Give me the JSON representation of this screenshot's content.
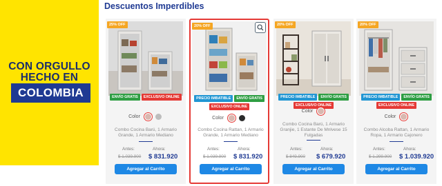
{
  "banner": {
    "line1": "CON ORGULLO",
    "line2": "HECHO EN",
    "country": "COLOMBIA",
    "colors": {
      "background": "#ffe400",
      "text": "#1a2d6b",
      "box": "#1f3a93"
    }
  },
  "section": {
    "title": "Descuentos Imperdibles"
  },
  "labels": {
    "color": "Color",
    "before": "Antes:",
    "now": "Ahora:",
    "add_to_cart": "Agregar al Carrito"
  },
  "products": [
    {
      "discount": "25% OFF",
      "tags_row1": [
        "ENVÍO GRATIS",
        "EXCLUSIVO ONLINE"
      ],
      "tags_row2": [],
      "swatches": [
        "#d9b8b0",
        "#bdbdbd"
      ],
      "name": "Combo Cocina Barú, 1 Armario Grande, 1 Armario Mediano",
      "old_price": "$ 1.039.900",
      "new_price": "$ 831.920"
    },
    {
      "discount": "20% OFF",
      "tags_row1": [
        "PRECIO IMBATIBLE",
        "ENVÍO GRATIS"
      ],
      "tags_row2": [
        "EXCLUSIVO ONLINE"
      ],
      "swatches": [
        "#d9b8b0",
        "#2b2b2b"
      ],
      "name": "Combo Cocina Rattan, 1 Armario Grande, 1 Armario Mediano",
      "old_price": "$ 1.039.900",
      "new_price": "$ 831.920"
    },
    {
      "discount": "20% OFF",
      "tags_row1": [
        "PRECIO IMBATIBLE",
        "ENVÍO GRATIS"
      ],
      "tags_row2": [
        "EXCLUSIVO ONLINE"
      ],
      "swatches": [
        "#d9b8b0"
      ],
      "name": "Combo Cocina Barú, 1 Armario Granjie, 1 Estante De Mnlvese 15 Fulgadas",
      "old_price": "$ 849.900",
      "new_price": "$ 679.920"
    },
    {
      "discount": "20% OFF",
      "tags_row1": [
        "PRECIO IMBATIBLE",
        "ENVÍO GRATIS"
      ],
      "tags_row2": [
        "EXCLUSIVO ONLINE"
      ],
      "swatches": [
        "#d9b8b0"
      ],
      "name": "Combo Alcoba Rattan, 1 Armario Ropa, 1 Armario Cajonero",
      "old_price": "$ 1.299.900",
      "new_price": "$ 1.039.920"
    }
  ]
}
